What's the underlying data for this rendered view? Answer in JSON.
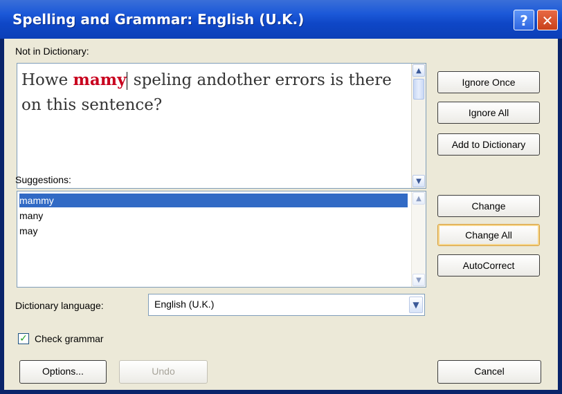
{
  "window": {
    "title": "Spelling and Grammar: English (U.K.)",
    "help_label": "?",
    "close_label": "✕"
  },
  "labels": {
    "not_in_dictionary": "Not in Dictionary:",
    "suggestions": "Suggestions:",
    "dictionary_language": "Dictionary language:",
    "check_grammar": "Check grammar"
  },
  "editor": {
    "text_before": "Howe ",
    "error_word": "mamy",
    "text_after": " speling andother errors is there on this sentence?"
  },
  "suggestions": [
    "mammy",
    "many",
    "may"
  ],
  "language": {
    "selected": "English (U.K.)"
  },
  "check_grammar_checked": true,
  "buttons": {
    "ignore_once": "Ignore Once",
    "ignore_all": "Ignore All",
    "add_to_dictionary": "Add to Dictionary",
    "change": "Change",
    "change_all": "Change All",
    "autocorrect": "AutoCorrect",
    "options": "Options...",
    "undo": "Undo",
    "cancel": "Cancel"
  },
  "colors": {
    "titlebar": "#0f47c7",
    "error_word": "#c8001e",
    "selection": "#316ac5",
    "dialog_bg": "#ece9d8"
  },
  "icons": {
    "help": "question-mark-icon",
    "close": "close-x-icon",
    "scroll_up": "chevron-up-icon",
    "scroll_down": "chevron-down-icon",
    "dropdown": "chevron-down-icon",
    "check": "checkmark-icon"
  }
}
